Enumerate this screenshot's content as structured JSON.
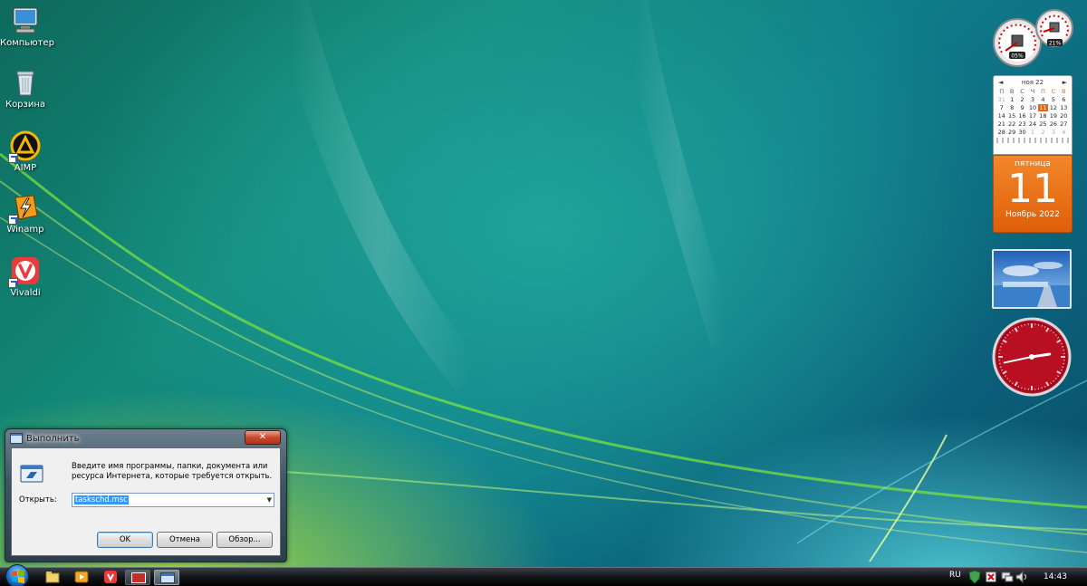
{
  "desktop": {
    "icons": [
      {
        "label": "Компьютер",
        "icon": "computer-icon"
      },
      {
        "label": "Корзина",
        "icon": "recycle-bin-icon"
      },
      {
        "label": "AIMP",
        "icon": "aimp-icon"
      },
      {
        "label": "Winamp",
        "icon": "winamp-icon"
      },
      {
        "label": "Vivaldi",
        "icon": "vivaldi-icon"
      }
    ]
  },
  "gadgets": {
    "cpu_meter": {
      "cpu": "05%",
      "memory": "21%"
    },
    "calendar": {
      "month_header": "ноя 22",
      "weekdays": [
        "П",
        "В",
        "С",
        "Ч",
        "П",
        "С",
        "В"
      ],
      "weeks": [
        [
          "31",
          "1",
          "2",
          "3",
          "4",
          "5",
          "6"
        ],
        [
          "7",
          "8",
          "9",
          "10",
          "11",
          "12",
          "13"
        ],
        [
          "14",
          "15",
          "16",
          "17",
          "18",
          "19",
          "20"
        ],
        [
          "21",
          "22",
          "23",
          "24",
          "25",
          "26",
          "27"
        ],
        [
          "28",
          "29",
          "30",
          "1",
          "2",
          "3",
          "4"
        ]
      ],
      "weekday_name": "пятница",
      "day": "11",
      "month_year": "Ноябрь 2022"
    },
    "clock": {
      "hour": 2,
      "minute": 43
    }
  },
  "run_dialog": {
    "title": "Выполнить",
    "close_label": "✕",
    "description": "Введите имя программы, папки, документа или ресурса Интернета, которые требуется открыть.",
    "open_label": "Открыть:",
    "input_value": "taskschd.msc",
    "ok_label": "OK",
    "cancel_label": "Отмена",
    "browse_label": "Обзор..."
  },
  "taskbar": {
    "language": "RU",
    "time": "14:43"
  },
  "colors": {
    "accent_orange": "#e8650c",
    "clock_red": "#c8102e",
    "selection_blue": "#3399ff"
  }
}
